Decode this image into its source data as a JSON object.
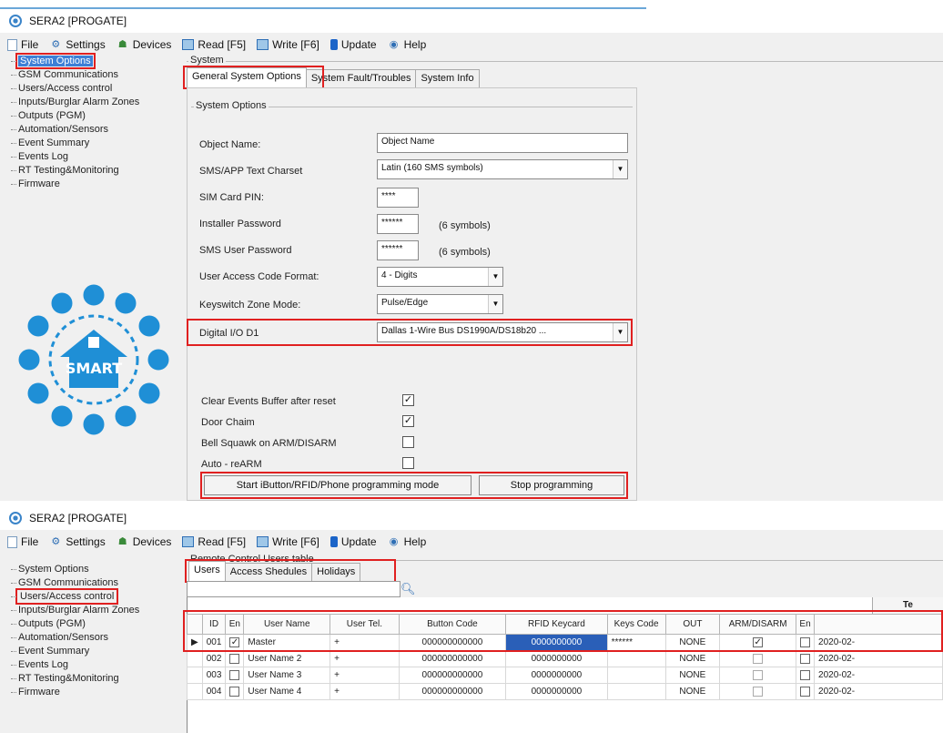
{
  "w1": {
    "title": "SERA2 [PROGATE]",
    "menu": [
      {
        "label": "File",
        "icon": "file-icon"
      },
      {
        "label": "Settings",
        "icon": "settings-icon"
      },
      {
        "label": "Devices",
        "icon": "devices-icon"
      },
      {
        "label": "Read [F5]",
        "icon": "read-icon"
      },
      {
        "label": "Write [F6]",
        "icon": "write-icon"
      },
      {
        "label": "Update",
        "icon": "update-icon"
      },
      {
        "label": "Help",
        "icon": "help-icon"
      }
    ],
    "tree": [
      "System Options",
      "GSM Communications",
      "Users/Access control",
      "Inputs/Burglar Alarm Zones",
      "Outputs (PGM)",
      "Automation/Sensors",
      "Event Summary",
      "Events Log",
      "RT Testing&Monitoring",
      "Firmware"
    ],
    "group_label": "System",
    "tabs": [
      "General System Options",
      "System Fault/Troubles",
      "System Info"
    ],
    "subgroup_label": "System Options",
    "fields": {
      "object_name_label": "Object Name:",
      "object_name_value": "Object Name",
      "charset_label": "SMS/APP Text Charset",
      "charset_value": "Latin (160 SMS symbols)",
      "sim_pin_label": "SIM Card PIN:",
      "sim_pin_value": "****",
      "installer_pwd_label": "Installer Password",
      "installer_pwd_value": "******",
      "installer_pwd_hint": "(6 symbols)",
      "sms_pwd_label": "SMS User Password",
      "sms_pwd_value": "******",
      "sms_pwd_hint": "(6 symbols)",
      "code_format_label": "User Access Code Format:",
      "code_format_value": "4 - Digits",
      "keyswitch_label": "Keyswitch Zone Mode:",
      "keyswitch_value": "Pulse/Edge",
      "digital_io_label": "Digital I/O D1",
      "digital_io_value": "Dallas 1-Wire Bus  DS1990A/DS18b20 ..."
    },
    "options": [
      {
        "label": "Clear Events Buffer after reset",
        "checked": true
      },
      {
        "label": "Door Chaim",
        "checked": true
      },
      {
        "label": "Bell Squawk on ARM/DISARM",
        "checked": false
      },
      {
        "label": "Auto - reARM",
        "checked": false
      }
    ],
    "buttons": {
      "start": "Start iButton/RFID/Phone  programming mode",
      "stop": "Stop  programming"
    },
    "logo_text": "SMART"
  },
  "w2": {
    "title": "SERA2 [PROGATE]",
    "tree": [
      "System Options",
      "GSM Communications",
      "Users/Access control",
      "Inputs/Burglar Alarm Zones",
      "Outputs (PGM)",
      "Automation/Sensors",
      "Event Summary",
      "Events Log",
      "RT Testing&Monitoring",
      "Firmware"
    ],
    "group_label": "Remote Control Users table",
    "tabs": [
      "Users",
      "Access Shedules",
      "Holidays"
    ],
    "group_header": "Te",
    "columns": [
      "",
      "ID",
      "En",
      "User Name",
      "User Tel.",
      "Button Code",
      "RFID Keycard",
      "Keys Code",
      "OUT",
      "ARM/DISARM",
      "En",
      ""
    ],
    "rows": [
      {
        "pointer": "▶",
        "id": "001",
        "en": true,
        "name": "Master",
        "tel": "+",
        "button": "000000000000",
        "rfid": "0000000000",
        "keys": "******",
        "out": "NONE",
        "arm": true,
        "en2": false,
        "date": "2020-02-"
      },
      {
        "pointer": "",
        "id": "002",
        "en": false,
        "name": "User Name 2",
        "tel": "+",
        "button": "000000000000",
        "rfid": "0000000000",
        "keys": "",
        "out": "NONE",
        "arm": false,
        "en2": false,
        "date": "2020-02-"
      },
      {
        "pointer": "",
        "id": "003",
        "en": false,
        "name": "User Name 3",
        "tel": "+",
        "button": "000000000000",
        "rfid": "0000000000",
        "keys": "",
        "out": "NONE",
        "arm": false,
        "en2": false,
        "date": "2020-02-"
      },
      {
        "pointer": "",
        "id": "004",
        "en": false,
        "name": "User Name 4",
        "tel": "+",
        "button": "000000000000",
        "rfid": "0000000000",
        "keys": "",
        "out": "NONE",
        "arm": false,
        "en2": false,
        "date": "2020-02-"
      }
    ]
  },
  "colors": {
    "accent": "#3d7fd6",
    "highlight": "#e02020",
    "selection": "#2a5fb8"
  }
}
